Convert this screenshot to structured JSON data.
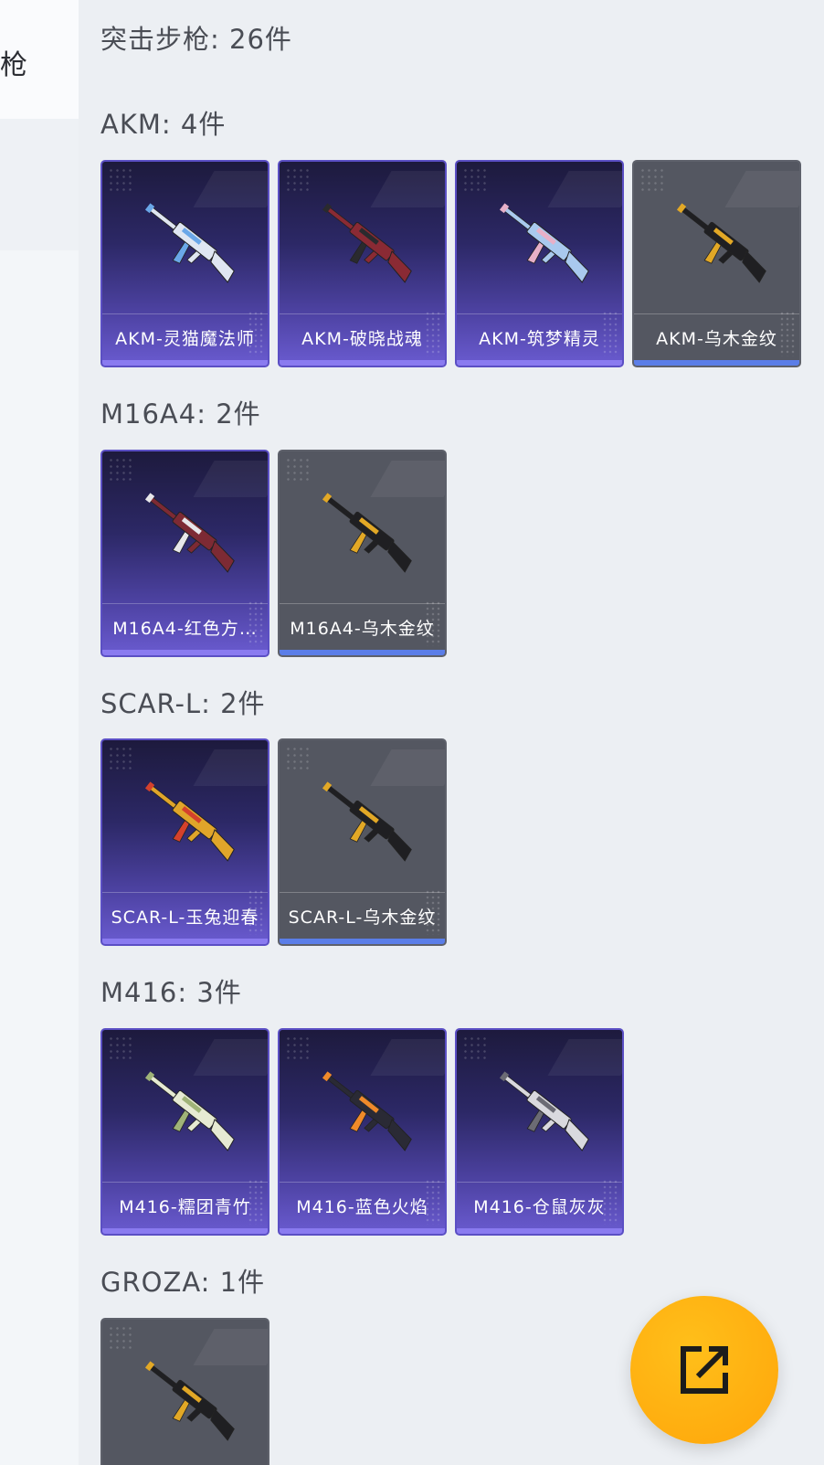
{
  "sidebar": {
    "active_item_label": "枪"
  },
  "summary": {
    "title": "突击步枪: 26件"
  },
  "groups": [
    {
      "title": "AKM: 4件",
      "items": [
        {
          "name": "AKM-灵猫魔法师",
          "style": "purple",
          "gun_color": "#dfe6f2",
          "accent": "#6aa7e8"
        },
        {
          "name": "AKM-破晓战魂",
          "style": "purple",
          "gun_color": "#8a2a34",
          "accent": "#2a2a2e"
        },
        {
          "name": "AKM-筑梦精灵",
          "style": "purple",
          "gun_color": "#a9c9ee",
          "accent": "#e7b0c8"
        },
        {
          "name": "AKM-乌木金纹",
          "style": "gray",
          "gun_color": "#1f1f22",
          "accent": "#e2a826"
        }
      ]
    },
    {
      "title": "M16A4: 2件",
      "items": [
        {
          "name": "M16A4-红色方…",
          "style": "purple",
          "gun_color": "#7d2a34",
          "accent": "#e7e7ea"
        },
        {
          "name": "M16A4-乌木金纹",
          "style": "gray",
          "gun_color": "#1f1f22",
          "accent": "#e2a826"
        }
      ]
    },
    {
      "title": "SCAR-L: 2件",
      "items": [
        {
          "name": "SCAR-L-玉兔迎春",
          "style": "purple",
          "gun_color": "#e0a52a",
          "accent": "#d4412c"
        },
        {
          "name": "SCAR-L-乌木金纹",
          "style": "gray",
          "gun_color": "#1f1f22",
          "accent": "#e2a826"
        }
      ]
    },
    {
      "title": "M416: 3件",
      "items": [
        {
          "name": "M416-糯团青竹",
          "style": "purple",
          "gun_color": "#e6ead3",
          "accent": "#9fb378"
        },
        {
          "name": "M416-蓝色火焰",
          "style": "purple",
          "gun_color": "#2a2a35",
          "accent": "#f08a2a"
        },
        {
          "name": "M416-仓鼠灰灰",
          "style": "purple",
          "gun_color": "#d9d9de",
          "accent": "#6b6b74"
        }
      ]
    },
    {
      "title": "GROZA: 1件",
      "items": [
        {
          "name": "",
          "style": "gray",
          "gun_color": "#1f1f22",
          "accent": "#e2a826"
        }
      ]
    }
  ],
  "fab": {
    "icon": "share-icon",
    "color": "#ffb20f"
  }
}
